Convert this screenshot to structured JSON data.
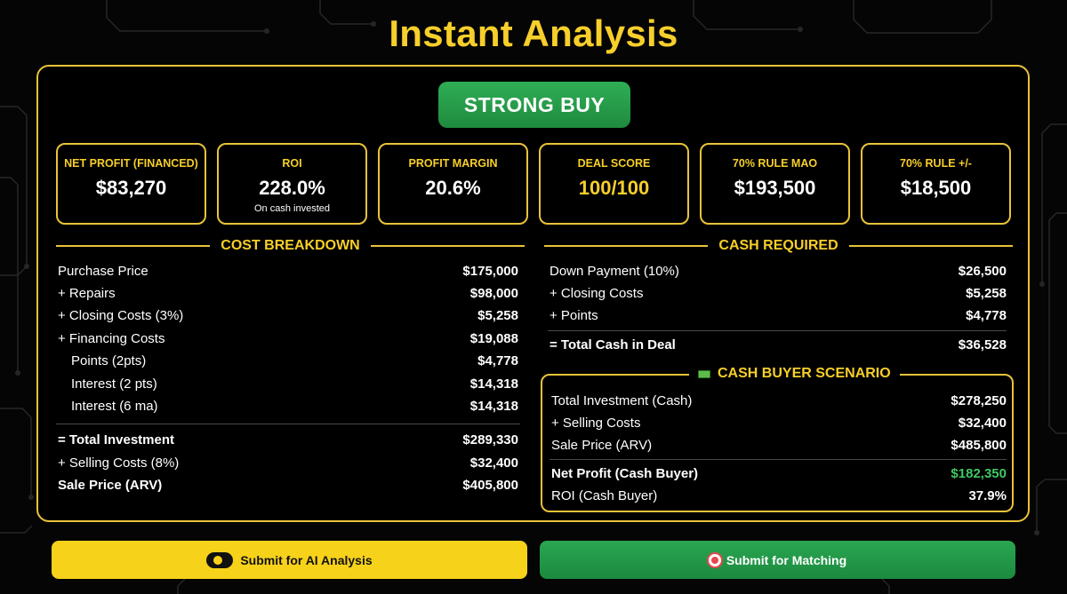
{
  "title": "Instant Analysis",
  "verdict": "STRONG BUY",
  "metrics": [
    {
      "label": "NET PROFIT (FINANCED)",
      "value": "$83,270"
    },
    {
      "label": "ROI",
      "value": "228.0%",
      "sub": "On cash invested"
    },
    {
      "label": "PROFIT MARGIN",
      "value": "20.6%"
    },
    {
      "label": "DEAL SCORE",
      "value": "100/100"
    },
    {
      "label": "70% RULE MAO",
      "value": "$193,500"
    },
    {
      "label": "70% RULE +/-",
      "value": "$18,500"
    }
  ],
  "cost_breakdown": {
    "title": "COST BREAKDOWN",
    "rows": [
      {
        "label": "Purchase Price",
        "value": "$175,000"
      },
      {
        "label": "+ Repairs",
        "value": "$98,000"
      },
      {
        "label": "+ Closing Costs (3%)",
        "value": "$5,258"
      },
      {
        "label": "+ Financing Costs",
        "value": "$19,088"
      },
      {
        "label": "Points (2pts)",
        "value": "$4,778"
      },
      {
        "label": "Interest (2 pts)",
        "value": "$14,318"
      },
      {
        "label": "Interest (6 ma)",
        "value": "$14,318"
      },
      {
        "label": "= Total Investment",
        "value": "$289,330"
      },
      {
        "label": "+ Selling Costs (8%)",
        "value": "$32,400"
      },
      {
        "label": "Sale Price (ARV)",
        "value": "$405,800"
      }
    ]
  },
  "cash_required": {
    "title": "CASH REQUIRED",
    "rows": [
      {
        "label": "Down Payment (10%)",
        "value": "$26,500"
      },
      {
        "label": "+ Closing Costs",
        "value": "$5,258"
      },
      {
        "label": "+ Points",
        "value": "$4,778"
      },
      {
        "label": "= Total Cash in Deal",
        "value": "$36,528"
      }
    ]
  },
  "cash_buyer": {
    "title": "CASH BUYER SCENARIO",
    "rows": [
      {
        "label": "Total Investment (Cash)",
        "value": "$278,250"
      },
      {
        "label": "+ Selling Costs",
        "value": "$32,400"
      },
      {
        "label": "Sale Price (ARV)",
        "value": "$485,800"
      },
      {
        "label": "Net Profit (Cash Buyer)",
        "value": "$182,350"
      },
      {
        "label": "ROI (Cash Buyer)",
        "value": "37.9%"
      }
    ]
  },
  "buttons": {
    "ai_analysis": "Submit for AI Analysis",
    "matching": "Submit for Matching"
  },
  "icons": {
    "cash_buyer": "money-icon",
    "ai_analysis": "ai-icon",
    "matching": "target-icon"
  },
  "colors": {
    "accent_gold": "#f7cf2a",
    "strong_buy_green": "#27a24c",
    "profit_green": "#3ec862",
    "background": "#050505"
  }
}
